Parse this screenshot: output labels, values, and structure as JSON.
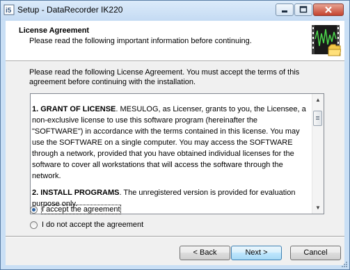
{
  "window": {
    "title": "Setup - DataRecorder IK220",
    "controls": {
      "minimize": "minimize-icon",
      "maximize": "maximize-icon",
      "close": "close-icon"
    }
  },
  "header": {
    "title": "License Agreement",
    "subtitle": "Please read the following important information before continuing.",
    "image": "waveform-folder-icon"
  },
  "intro": "Please read the following License Agreement. You must accept the terms of this agreement before continuing with the installation.",
  "license": {
    "paragraphs": [
      {
        "heading": "1. GRANT OF LICENSE",
        "body": ". MESULOG, as Licenser, grants to you, the Licensee, a non-exclusive license to use this software program (hereinafter the \"SOFTWARE\") in accordance with the terms contained in this license. You may use the SOFTWARE on a single computer. You may access the SOFTWARE through a network, provided that you have obtained individual licenses for the software to cover all workstations that will access the software through the network."
      },
      {
        "heading": "2. INSTALL PROGRAMS",
        "body": ". The unregistered version is provided for evaluation purpose only."
      }
    ]
  },
  "options": {
    "accept": {
      "label": "I accept the agreement",
      "selected": true
    },
    "decline": {
      "label": "I do not accept the agreement",
      "selected": false
    }
  },
  "buttons": {
    "back": "< Back",
    "next": "Next >",
    "cancel": "Cancel"
  },
  "colors": {
    "title_bar": "#c5dbf3",
    "default_button": "#bee6fd",
    "close_button": "#c4432e"
  }
}
